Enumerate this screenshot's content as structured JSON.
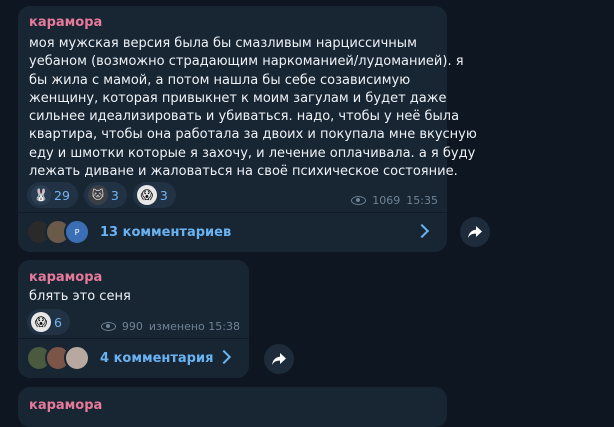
{
  "messages": [
    {
      "author": "карамора",
      "text": "моя мужская версия была бы смазливым нарциссичным\nуебаном (возможно страдающим наркоманией/лудоманией). я\nбы жила с мамой, а потом нашла бы себе созависимую\nженщину, которая привыкнет к моим загулам и будет даже\nсильнее идеализировать и убиваться. надо, чтобы у неё была\nквартира, чтобы она работала за двоих и покупала мне вкусную\nеду и шмотки которые я захочу, и лечение оплачивала. а я буду\nлежать диване и жаловаться на своё психическое состояние.",
      "reactions": [
        {
          "icon": "bunny-emoji",
          "glyph": "🐰",
          "count": "29"
        },
        {
          "icon": "cats-emoji",
          "glyph": "🐱",
          "count": "3"
        },
        {
          "icon": "screaming-face-emoji",
          "glyph": "😱",
          "count": "3"
        }
      ],
      "views": "1069",
      "time": "15:35",
      "comments_label": "13 комментариев",
      "avatar_extra_letter": "P"
    },
    {
      "author": "карамора",
      "text": "блять это сеня",
      "reactions": [
        {
          "icon": "screaming-face-emoji",
          "glyph": "😱",
          "count": "6"
        }
      ],
      "views": "990",
      "time": "изменено 15:38",
      "comments_label": "4 комментария"
    },
    {
      "author": "карамора"
    }
  ],
  "colors": {
    "background": "#0e1621",
    "bubble": "#182533",
    "author": "#e67a9a",
    "link": "#6ab3f3",
    "meta": "#6f8396"
  }
}
